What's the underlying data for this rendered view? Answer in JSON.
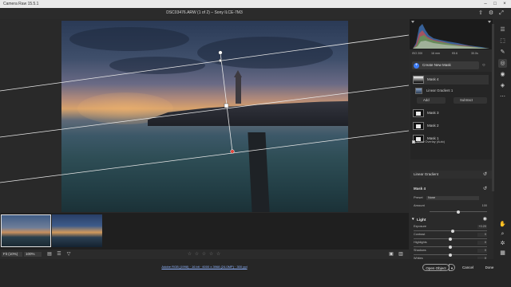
{
  "window": {
    "app_title": "Camera Raw 15.5.1",
    "controls": {
      "minimize": "–",
      "maximize": "□",
      "close": "×"
    }
  },
  "header": {
    "file_title": "DSC03476.ARW (1 of 2) – Sony ILCE-7M3",
    "icons": [
      "export-icon",
      "settings-icon",
      "fullscreen-icon"
    ],
    "icon_glyphs": {
      "export": "⇧",
      "settings": "⚙",
      "fullscreen": "⤢"
    }
  },
  "filmstrip": {
    "thumbnails": [
      {
        "name": "DSC03476.ARW",
        "selected": true
      },
      {
        "name": "second-image",
        "selected": false
      }
    ]
  },
  "statusbar": {
    "zoom_fit": "Fit (10%)",
    "zoom_pct": "100%",
    "rating_stars": "☆ ☆ ☆ ☆ ☆",
    "icons": [
      "filmstrip-toggle-icon",
      "sort-icon",
      "filter-icon",
      "before-after-icon",
      "compare-icon"
    ],
    "glyphs": {
      "filmstrip": "▤",
      "sort": "☰",
      "filter": "▽",
      "before_after": "▣",
      "compare": "▥"
    }
  },
  "footer": {
    "workflow": "Adobe RGB (1998) · 16 bit · 6000 x 3968 (24.0MP) · 300 ppi",
    "open_label": "Open Object",
    "open_drop": "▾",
    "cancel_label": "Cancel",
    "done_label": "Done"
  },
  "panel": {
    "camera_info": {
      "iso": "ISO 200",
      "focal": "16 mm",
      "aperture": "f/5.6",
      "shutter": "30.0s"
    },
    "create_mask": "Create New Mask",
    "masks": [
      {
        "label": "Mask 4",
        "active": true,
        "thumb": "gradient"
      },
      {
        "label": "Mask 3",
        "active": false,
        "thumb": "white"
      },
      {
        "label": "Mask 2",
        "active": false,
        "thumb": "white"
      },
      {
        "label": "Mask 1",
        "active": false,
        "thumb": "white"
      }
    ],
    "sub_mask": "Linear Gradient 1",
    "add_label": "Add",
    "subtract_label": "Subtract",
    "show_overlay": "Show Overlay",
    "auto_label": "(Auto)",
    "gradient_title": "Linear Gradient",
    "mask_title": "Mask 4",
    "preset_label": "Preset",
    "preset_value": "None",
    "amount_label": "Amount",
    "amount_value": "100",
    "light_label": "Light",
    "sliders": [
      {
        "label": "Exposure",
        "value": "+0.20",
        "pos": 0.53
      },
      {
        "label": "Contrast",
        "value": "0",
        "pos": 0.5
      },
      {
        "label": "Highlights",
        "value": "0",
        "pos": 0.5
      },
      {
        "label": "Shadows",
        "value": "0",
        "pos": 0.5
      },
      {
        "label": "Whites",
        "value": "0",
        "pos": 0.5
      },
      {
        "label": "Blacks",
        "value": "0",
        "pos": 0.5
      }
    ]
  },
  "toolstrip": {
    "tools": [
      "edit-icon",
      "crop-icon",
      "heal-icon",
      "mask-icon",
      "redeye-icon",
      "presets-icon",
      "more-icon"
    ],
    "glyphs": [
      "☰",
      "⬚",
      "✎",
      "◎",
      "◉",
      "◈",
      "⋯"
    ],
    "bottom_tools": [
      "hand-icon",
      "zoom-icon",
      "sampler-icon",
      "grid-icon"
    ],
    "bottom_glyphs": [
      "✋",
      "⌕",
      "✲",
      "▦"
    ]
  }
}
